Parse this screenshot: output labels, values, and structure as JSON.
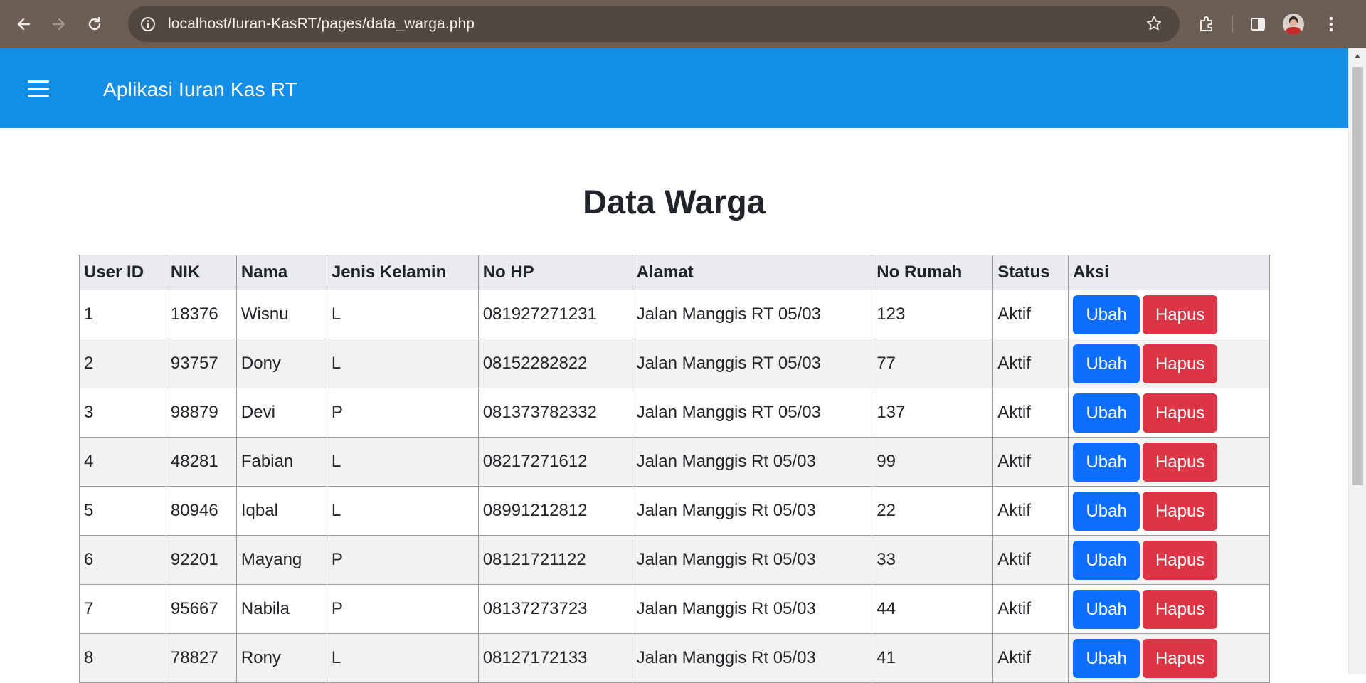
{
  "browser": {
    "url": "localhost/Iuran-KasRT/pages/data_warga.php",
    "icons": [
      "back-arrow-icon",
      "forward-arrow-icon",
      "reload-icon",
      "site-info-icon",
      "bookmark-star-icon",
      "extensions-icon",
      "side-panel-icon",
      "profile-avatar-icon",
      "more-menu-icon"
    ]
  },
  "navbar": {
    "brand": "Aplikasi Iuran Kas RT",
    "background_color": "#138fea"
  },
  "page": {
    "title": "Data Warga"
  },
  "table": {
    "headers": [
      "User ID",
      "NIK",
      "Nama",
      "Jenis Kelamin",
      "No HP",
      "Alamat",
      "No Rumah",
      "Status",
      "Aksi"
    ],
    "rows": [
      {
        "user_id": "1",
        "nik": "18376",
        "nama": "Wisnu",
        "jk": "L",
        "hp": "081927271231",
        "alamat": "Jalan Manggis RT 05/03",
        "rumah": "123",
        "status": "Aktif"
      },
      {
        "user_id": "2",
        "nik": "93757",
        "nama": "Dony",
        "jk": "L",
        "hp": "08152282822",
        "alamat": "Jalan Manggis RT 05/03",
        "rumah": "77",
        "status": "Aktif"
      },
      {
        "user_id": "3",
        "nik": "98879",
        "nama": "Devi",
        "jk": "P",
        "hp": "081373782332",
        "alamat": "Jalan Manggis RT 05/03",
        "rumah": "137",
        "status": "Aktif"
      },
      {
        "user_id": "4",
        "nik": "48281",
        "nama": "Fabian",
        "jk": "L",
        "hp": "08217271612",
        "alamat": "Jalan Manggis Rt 05/03",
        "rumah": "99",
        "status": "Aktif"
      },
      {
        "user_id": "5",
        "nik": "80946",
        "nama": "Iqbal",
        "jk": "L",
        "hp": "08991212812",
        "alamat": "Jalan Manggis Rt 05/03",
        "rumah": "22",
        "status": "Aktif"
      },
      {
        "user_id": "6",
        "nik": "92201",
        "nama": "Mayang",
        "jk": "P",
        "hp": "08121721122",
        "alamat": "Jalan Manggis Rt 05/03",
        "rumah": "33",
        "status": "Aktif"
      },
      {
        "user_id": "7",
        "nik": "95667",
        "nama": "Nabila",
        "jk": "P",
        "hp": "08137273723",
        "alamat": "Jalan Manggis Rt 05/03",
        "rumah": "44",
        "status": "Aktif"
      },
      {
        "user_id": "8",
        "nik": "78827",
        "nama": "Rony",
        "jk": "L",
        "hp": "08127172133",
        "alamat": "Jalan Manggis Rt 05/03",
        "rumah": "41",
        "status": "Aktif"
      }
    ],
    "actions": {
      "edit_label": "Ubah",
      "delete_label": "Hapus",
      "edit_color": "#0d6efd",
      "delete_color": "#dc3545"
    }
  }
}
